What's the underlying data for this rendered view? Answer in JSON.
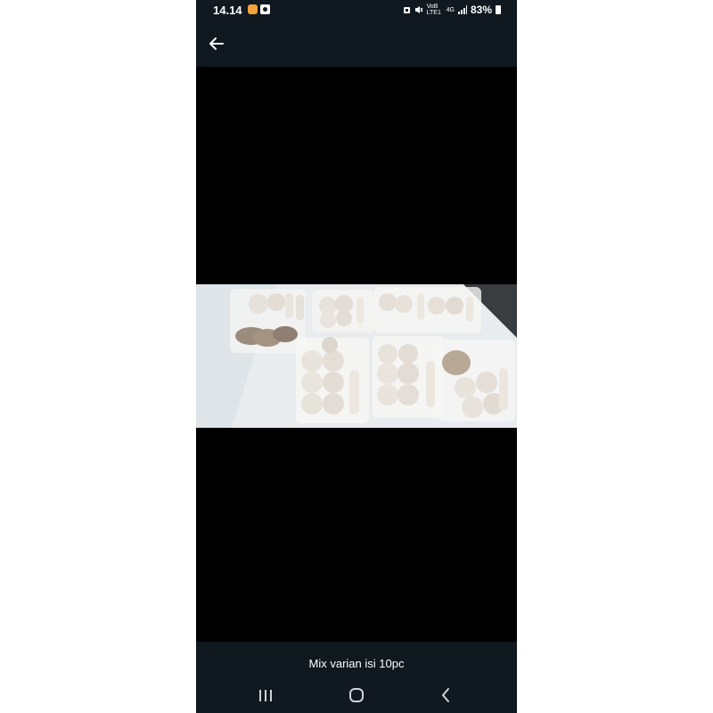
{
  "status_bar": {
    "time": "14.14",
    "network_labels": [
      "VoB LTE1",
      "4G"
    ],
    "battery": "83%"
  },
  "app_bar": {
    "back_icon": "arrow-left-icon"
  },
  "image": {
    "subject": "frozen meatballs and sausages in vacuum-sealed packs"
  },
  "caption": "Mix varian isi 10pc",
  "nav_bar": {
    "icons": [
      "recent-apps-icon",
      "home-icon",
      "back-icon"
    ]
  },
  "colors": {
    "bar_background": "#101820",
    "viewer_background": "#000000"
  }
}
